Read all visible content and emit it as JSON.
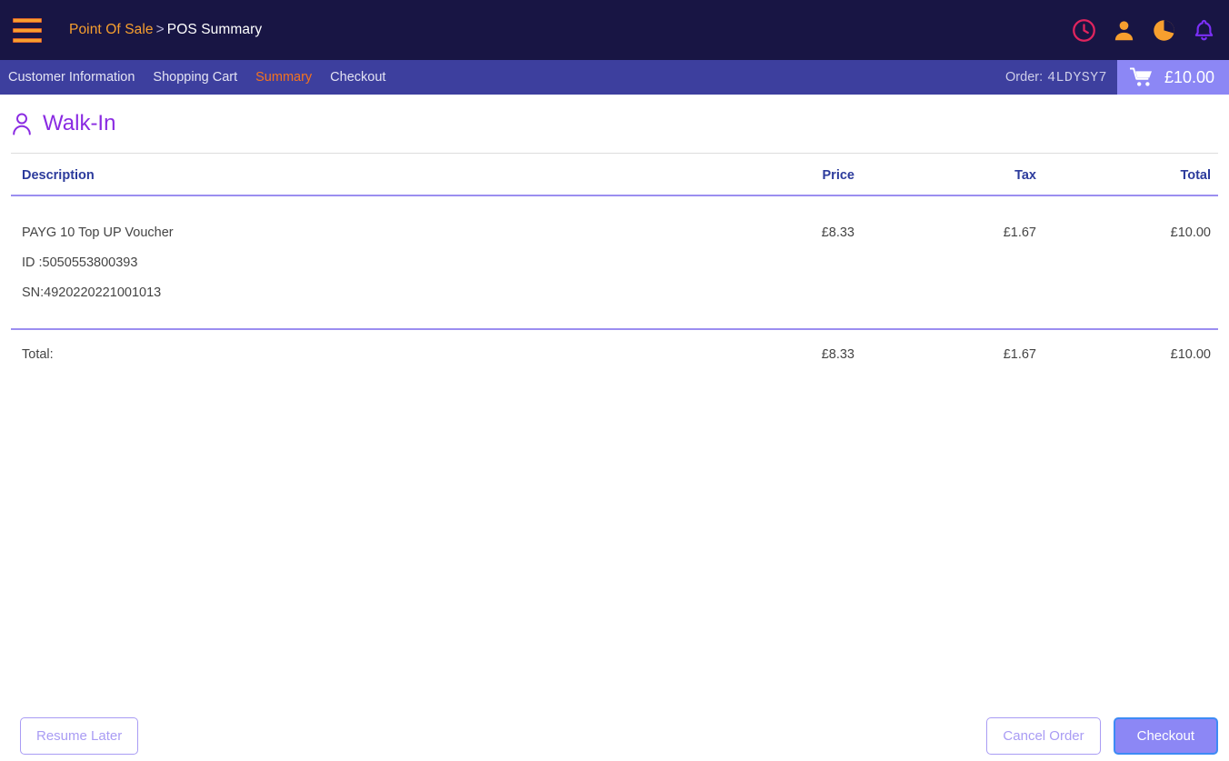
{
  "topbar": {
    "menu_icon": "hamburger-menu-icon",
    "breadcrumb": {
      "parent": "Point Of Sale",
      "separator": ">",
      "current": "POS Summary"
    },
    "icons": [
      {
        "name": "clock-icon",
        "color": "#e0245e"
      },
      {
        "name": "user-icon",
        "color": "#f79f2e"
      },
      {
        "name": "pie-chart-icon",
        "color": "#f79f2e"
      },
      {
        "name": "bell-icon",
        "color": "#7b2ff7"
      }
    ],
    "background": "#181544"
  },
  "navbar": {
    "background": "#3d3f9e",
    "tabs": [
      {
        "label": "Customer Information",
        "active": false
      },
      {
        "label": "Shopping Cart",
        "active": false
      },
      {
        "label": "Summary",
        "active": true
      },
      {
        "label": "Checkout",
        "active": false
      }
    ],
    "active_color": "#f4731f",
    "order": {
      "label": "Order:",
      "code": "4LDYSY7"
    },
    "cart": {
      "icon": "shopping-cart-icon",
      "total": "£10.00",
      "background": "#8c87f5"
    }
  },
  "customer": {
    "icon": "person-outline-icon",
    "name": "Walk-In",
    "color": "#8a2be2"
  },
  "table": {
    "headers": {
      "description": "Description",
      "price": "Price",
      "tax": "Tax",
      "total": "Total"
    },
    "header_color": "#2c3b9c",
    "border_color": "#9b8ef0",
    "rows": [
      {
        "description": "PAYG 10 Top UP Voucher",
        "id_line": "ID :5050553800393",
        "sn_line": "SN:4920220221001013",
        "price": "£8.33",
        "tax": "£1.67",
        "total": "£10.00"
      }
    ],
    "totals": {
      "label": "Total:",
      "price": "£8.33",
      "tax": "£1.67",
      "total": "£10.00"
    }
  },
  "footer": {
    "resume_later": "Resume Later",
    "cancel_order": "Cancel Order",
    "checkout": "Checkout",
    "primary_color": "#8c87f5",
    "outline_color": "#a99cf4"
  }
}
